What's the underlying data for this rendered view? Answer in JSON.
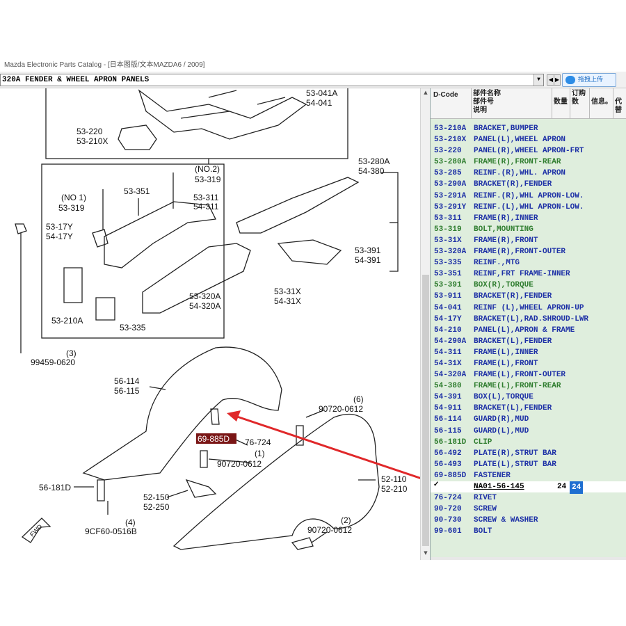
{
  "window": {
    "title": "Mazda Electronic Parts Catalog - [日本图版/文本MAZDA6 / 2009]"
  },
  "toolbar": {
    "page_select_value": "320A  FENDER & WHEEL APRON PANELS",
    "upload_button_label": "拖拽上传",
    "upload_icon": "cloud-upload-icon"
  },
  "diagram": {
    "labels": {
      "l53041A": "53-041A",
      "l54041": "54-041",
      "l53220": "53-220",
      "l53210X": "53-210X",
      "l53280A": "53-280A",
      "l54380": "54-380",
      "no2": "(NO.2)",
      "l53319b": "53-319",
      "l53351": "53-351",
      "no1": "(NO 1)",
      "l53319a": "53-319",
      "l53311": "53-311",
      "l54311": "54-311",
      "l5317Y": "53-17Y",
      "l5417Y": "54-17Y",
      "l53391": "53-391",
      "l54391": "54-391",
      "l53320A": "53-320A",
      "l54320A": "54-320A",
      "l5331X": "53-31X",
      "l5431X": "54-31X",
      "l53210A": "53-210A",
      "l53335": "53-335",
      "q3": "(3)",
      "l99459": "99459-0620",
      "l56114": "56-114",
      "l56115": "56-115",
      "q6": "(6)",
      "l90720a": "90720-0612",
      "l69885D": "69-885D",
      "l76724": "76-724",
      "q1": "(1)",
      "l90720b": "90720-0612",
      "l52110": "52-110",
      "l52210": "52-210",
      "l56181D": "56-181D",
      "l52150": "52-150",
      "l52250": "52-250",
      "q4": "(4)",
      "l9CF60": "9CF60-0516B",
      "q2": "(2)",
      "l90720c": "90720-0612",
      "fwd": "FWD"
    },
    "highlight_color": "#7a1616",
    "arrow_color": "#e0282a"
  },
  "parts_panel": {
    "headers": {
      "dcode": "D-Code",
      "name_l1": "部件名称",
      "name_l2": "部件号",
      "name_l3": "说明",
      "qty": "数量",
      "order_qty": "订购数",
      "info": "信息。",
      "sub": "代替"
    },
    "rows": [
      {
        "code": "53-210A",
        "desc": "BRACKET,BUMPER",
        "color": "blue"
      },
      {
        "code": "53-210X",
        "desc": "PANEL(L),WHEEL APRON",
        "color": "blue"
      },
      {
        "code": "53-220",
        "desc": "PANEL(R),WHEEL APRON-FRT",
        "color": "blue"
      },
      {
        "code": "53-280A",
        "desc": "FRAME(R),FRONT-REAR",
        "color": "green"
      },
      {
        "code": "53-285",
        "desc": "REINF.(R),WHL. APRON",
        "color": "blue"
      },
      {
        "code": "53-290A",
        "desc": "BRACKET(R),FENDER",
        "color": "blue"
      },
      {
        "code": "53-291A",
        "desc": "REINF.(R),WHL APRON-LOW.",
        "color": "blue"
      },
      {
        "code": "53-291Y",
        "desc": "REINF.(L),WHL APRON-LOW.",
        "color": "blue"
      },
      {
        "code": "53-311",
        "desc": "FRAME(R),INNER",
        "color": "blue"
      },
      {
        "code": "53-319",
        "desc": "BOLT,MOUNTING",
        "color": "green"
      },
      {
        "code": "53-31X",
        "desc": "FRAME(R),FRONT",
        "color": "blue"
      },
      {
        "code": "53-320A",
        "desc": "FRAME(R),FRONT-OUTER",
        "color": "blue"
      },
      {
        "code": "53-335",
        "desc": "REINF.,MTG",
        "color": "blue"
      },
      {
        "code": "53-351",
        "desc": "REINF,FRT FRAME-INNER",
        "color": "blue"
      },
      {
        "code": "53-391",
        "desc": "BOX(R),TORQUE",
        "color": "green"
      },
      {
        "code": "53-911",
        "desc": "BRACKET(R),FENDER",
        "color": "blue"
      },
      {
        "code": "54-041",
        "desc": "REINF (L),WHEEL APRON-UP",
        "color": "blue"
      },
      {
        "code": "54-17Y",
        "desc": "BRACKET(L),RAD.SHROUD-LWR",
        "color": "blue"
      },
      {
        "code": "54-210",
        "desc": "PANEL(L),APRON & FRAME",
        "color": "blue"
      },
      {
        "code": "54-290A",
        "desc": "BRACKET(L),FENDER",
        "color": "blue"
      },
      {
        "code": "54-311",
        "desc": "FRAME(L),INNER",
        "color": "blue"
      },
      {
        "code": "54-31X",
        "desc": "FRAME(L),FRONT",
        "color": "blue"
      },
      {
        "code": "54-320A",
        "desc": "FRAME(L),FRONT-OUTER",
        "color": "blue"
      },
      {
        "code": "54-380",
        "desc": "FRAME(L),FRONT-REAR",
        "color": "green"
      },
      {
        "code": "54-391",
        "desc": "BOX(L),TORQUE",
        "color": "blue"
      },
      {
        "code": "54-911",
        "desc": "BRACKET(L),FENDER",
        "color": "blue"
      },
      {
        "code": "56-114",
        "desc": "GUARD(R),MUD",
        "color": "blue"
      },
      {
        "code": "56-115",
        "desc": "GUARD(L),MUD",
        "color": "blue"
      },
      {
        "code": "56-181D",
        "desc": "CLIP",
        "color": "green"
      },
      {
        "code": "56-492",
        "desc": "PLATE(R),STRUT BAR",
        "color": "blue"
      },
      {
        "code": "56-493",
        "desc": "PLATE(L),STRUT BAR",
        "color": "blue"
      },
      {
        "code": "69-885D",
        "desc": "FASTENER",
        "color": "blue"
      }
    ],
    "selected_row": {
      "check": "✓",
      "part_number": "NA01-56-145",
      "qty": "24",
      "order_qty": "24"
    },
    "rows_after": [
      {
        "code": "76-724",
        "desc": "RIVET",
        "color": "blue"
      },
      {
        "code": "90-720",
        "desc": "SCREW",
        "color": "blue"
      },
      {
        "code": "90-730",
        "desc": "SCREW & WASHER",
        "color": "blue"
      },
      {
        "code": "99-601",
        "desc": "BOLT",
        "color": "blue"
      }
    ]
  }
}
